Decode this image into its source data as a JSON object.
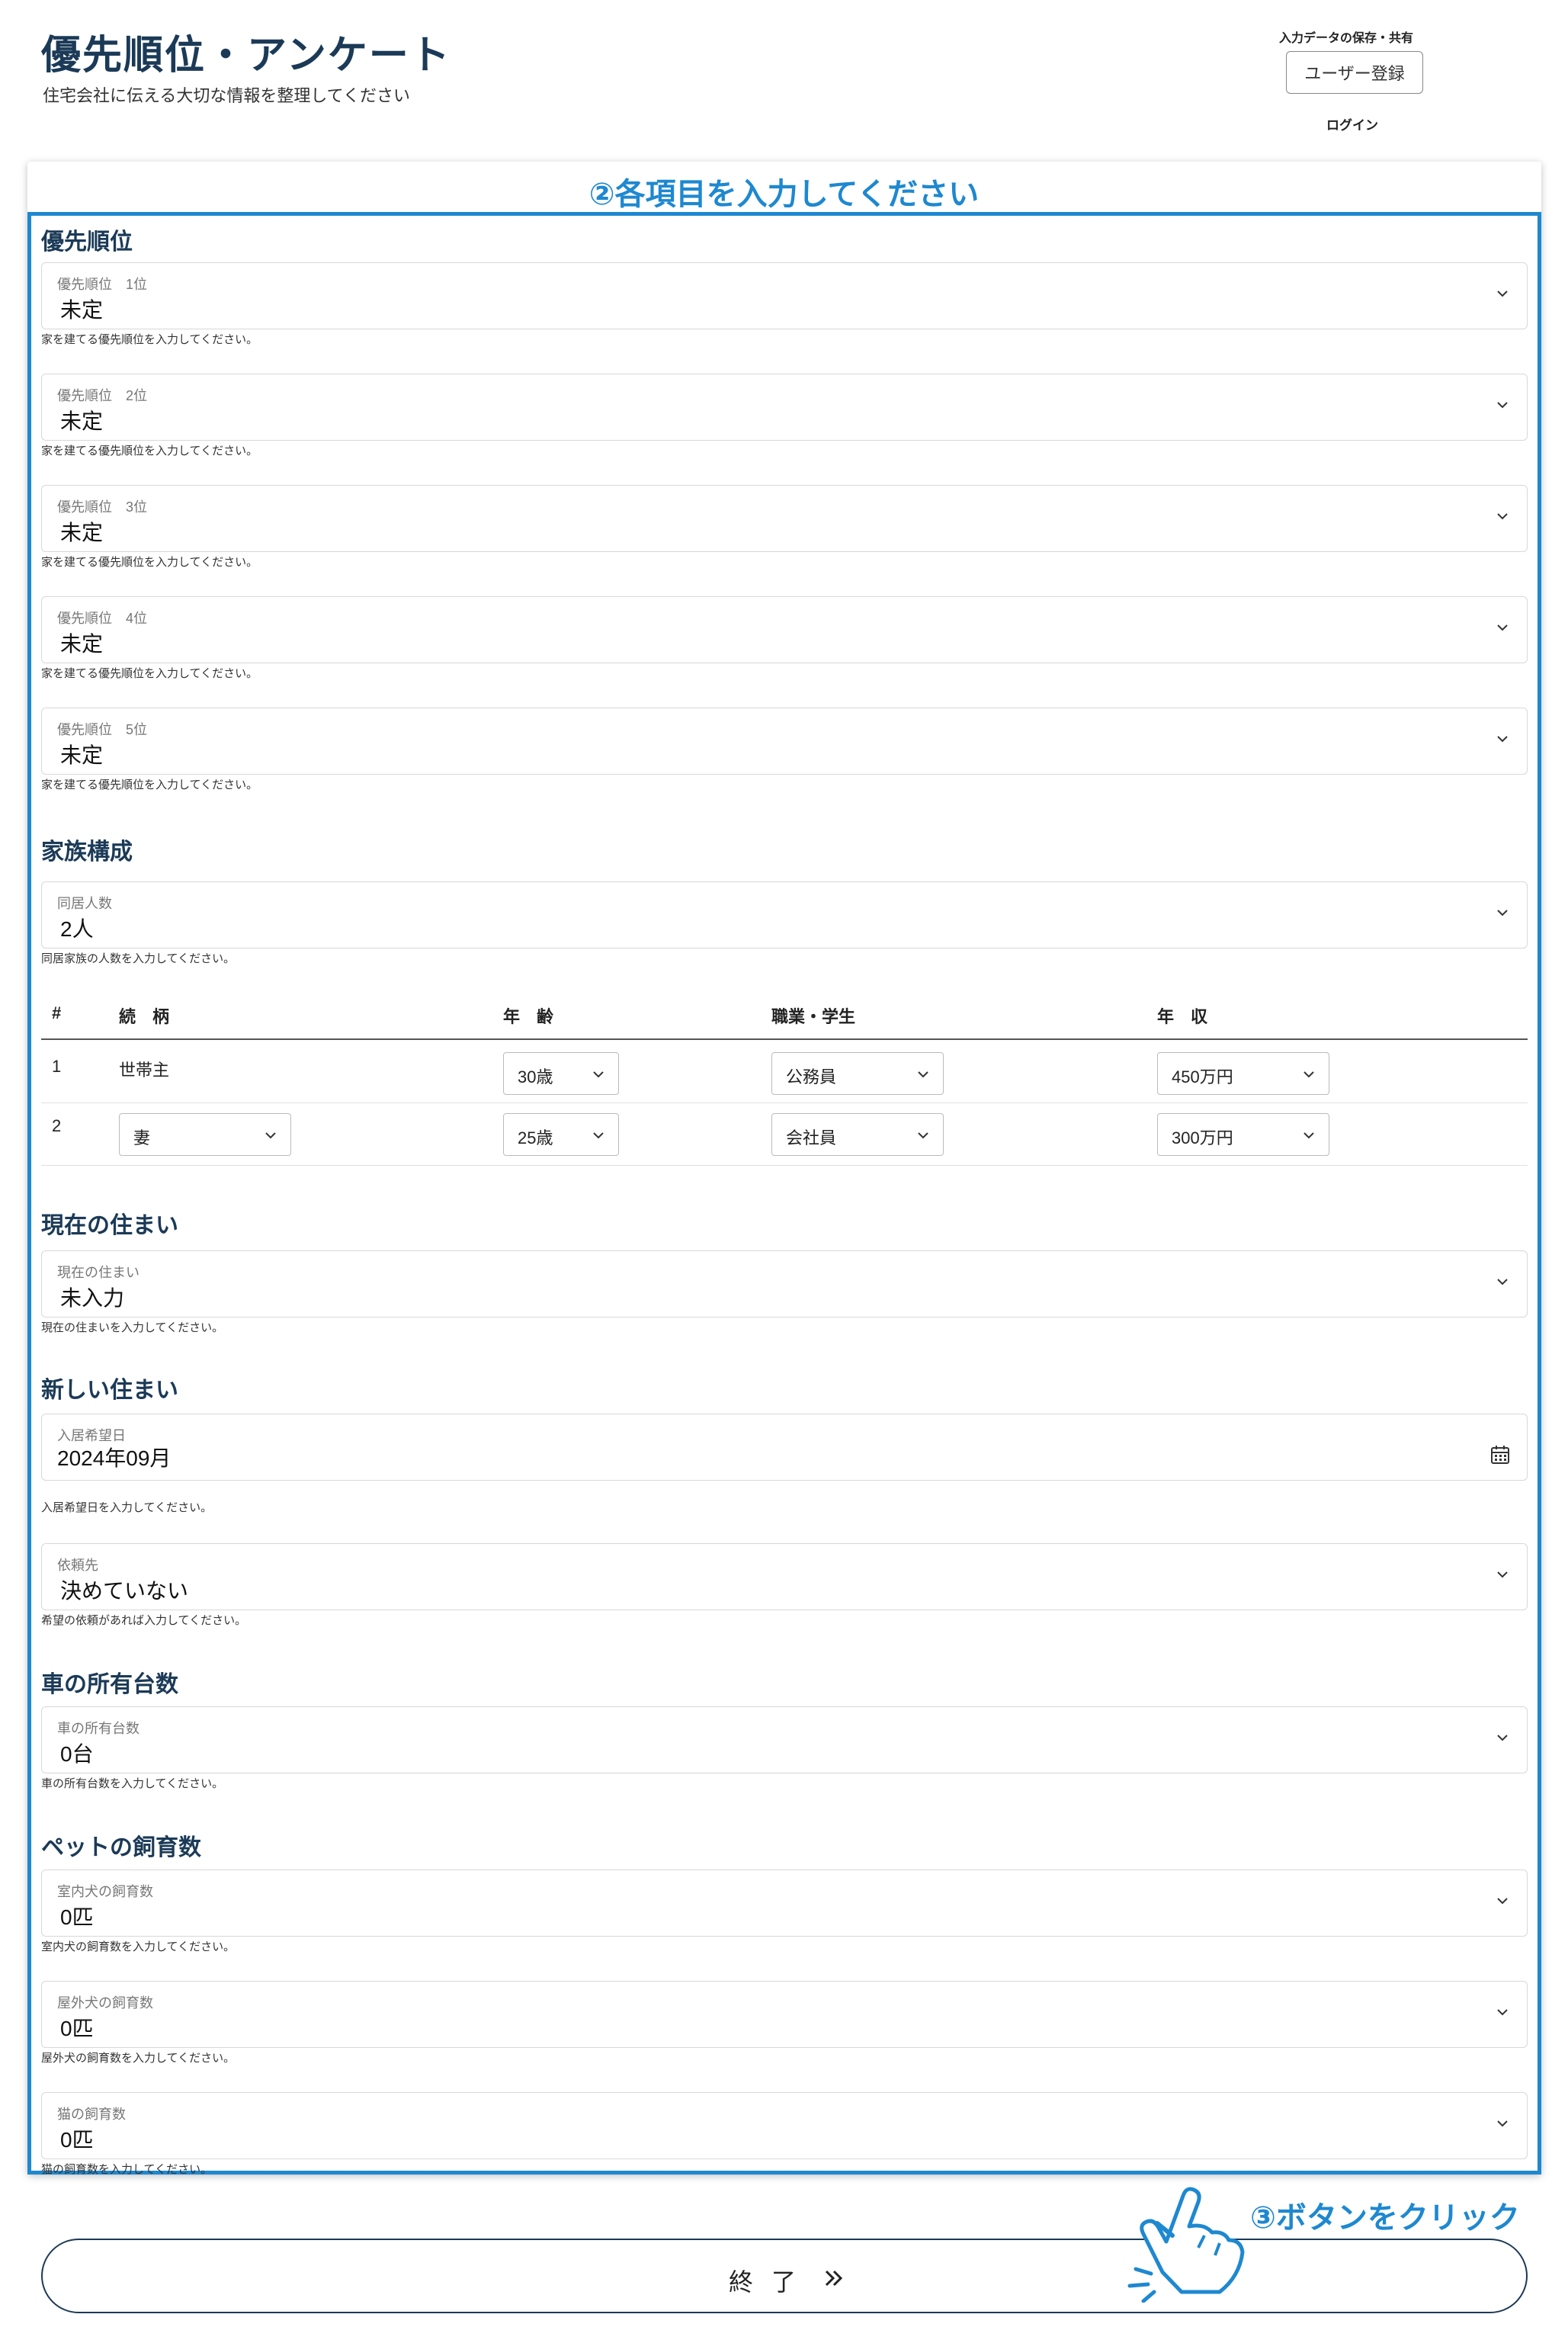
{
  "header": {
    "title": "優先順位・アンケート",
    "subtitle": "住宅会社に伝える大切な情報を整理してください",
    "save_label": "入力データの保存・共有",
    "register_button": "ユーザー登録",
    "login_link": "ログイン"
  },
  "step2_label": "②各項目を入力してください",
  "priority": {
    "title": "優先順位",
    "fields": [
      {
        "label": "優先順位　1位",
        "value": "未定",
        "helper": "家を建てる優先順位を入力してください。"
      },
      {
        "label": "優先順位　2位",
        "value": "未定",
        "helper": "家を建てる優先順位を入力してください。"
      },
      {
        "label": "優先順位　3位",
        "value": "未定",
        "helper": "家を建てる優先順位を入力してください。"
      },
      {
        "label": "優先順位　4位",
        "value": "未定",
        "helper": "家を建てる優先順位を入力してください。"
      },
      {
        "label": "優先順位　5位",
        "value": "未定",
        "helper": "家を建てる優先順位を入力してください。"
      }
    ]
  },
  "family": {
    "title": "家族構成",
    "count_field": {
      "label": "同居人数",
      "value": "2人",
      "helper": "同居家族の人数を入力してください。"
    },
    "table": {
      "headers": [
        "#",
        "続　柄",
        "年　齢",
        "職業・学生",
        "年　収"
      ],
      "rows": [
        {
          "num": "1",
          "relation": "世帯主",
          "age": "30歳",
          "job": "公務員",
          "income": "450万円"
        },
        {
          "num": "2",
          "relation": "妻",
          "age": "25歳",
          "job": "会社員",
          "income": "300万円"
        }
      ]
    }
  },
  "current_home": {
    "title": "現在の住まい",
    "field": {
      "label": "現在の住まい",
      "value": "未入力",
      "helper": "現在の住まいを入力してください。"
    }
  },
  "new_home": {
    "title": "新しい住まい",
    "move_in": {
      "label": "入居希望日",
      "value": "2024年09月",
      "helper": "入居希望日を入力してください。"
    },
    "builder": {
      "label": "依頼先",
      "value": "決めていない",
      "helper": "希望の依頼があれば入力してください。"
    }
  },
  "cars": {
    "title": "車の所有台数",
    "field": {
      "label": "車の所有台数",
      "value": "0台",
      "helper": "車の所有台数を入力してください。"
    }
  },
  "pets": {
    "title": "ペットの飼育数",
    "fields": [
      {
        "label": "室内犬の飼育数",
        "value": "0匹",
        "helper": "室内犬の飼育数を入力してください。"
      },
      {
        "label": "屋外犬の飼育数",
        "value": "0匹",
        "helper": "屋外犬の飼育数を入力してください。"
      },
      {
        "label": "猫の飼育数",
        "value": "0匹",
        "helper": "猫の飼育数を入力してください。"
      }
    ]
  },
  "footer": {
    "finish_button": "終了",
    "step3_label": "③ボタンをクリック"
  },
  "colors": {
    "accent": "#1e88d0",
    "title": "#1b3a57"
  }
}
